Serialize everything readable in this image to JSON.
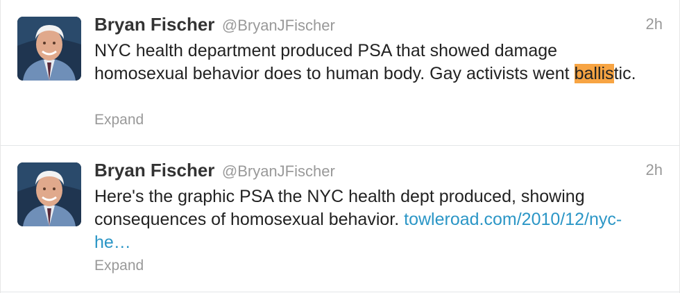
{
  "tweets": [
    {
      "fullname": "Bryan Fischer",
      "username": "@BryanJFischer",
      "time": "2h",
      "text_before": "NYC health department produced PSA that showed damage homosexual behavior does to human body. Gay activists went ",
      "highlight": "ballis",
      "text_after": "tic.",
      "expand": "Expand"
    },
    {
      "fullname": "Bryan Fischer",
      "username": "@BryanJFischer",
      "time": "2h",
      "text": "Here's the graphic PSA the NYC health dept produced, showing consequences of homosexual behavior. ",
      "link": "towleroad.com/2010/12/nyc-he…",
      "expand": "Expand"
    }
  ],
  "colors": {
    "highlight": "#f7a443",
    "link": "#2b96c6",
    "meta": "#999999"
  }
}
